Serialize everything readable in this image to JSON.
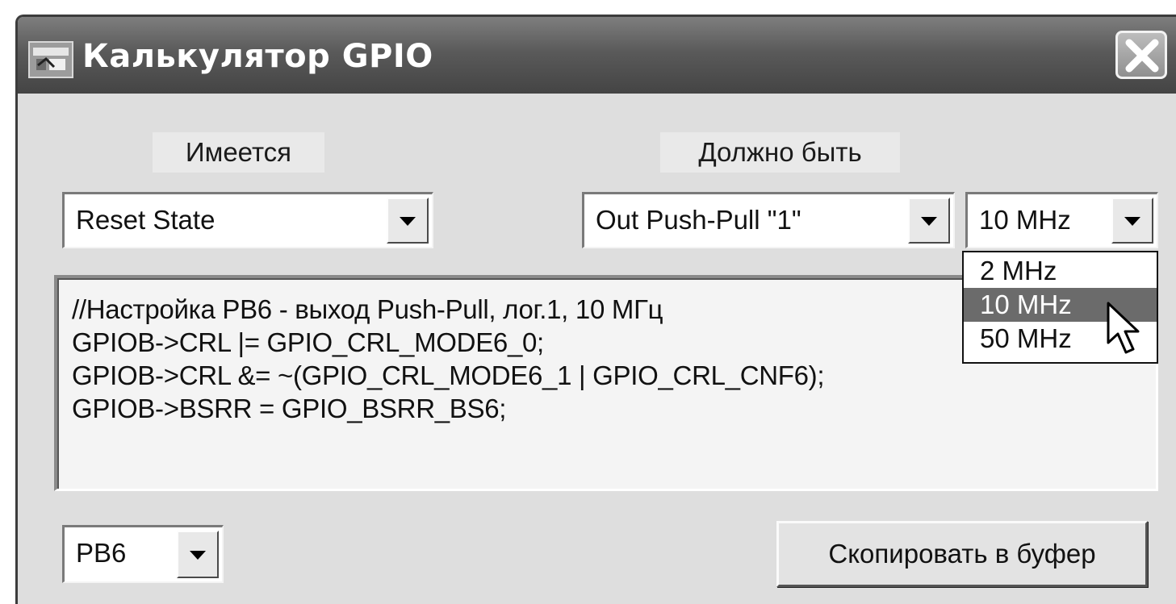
{
  "window": {
    "title": "Калькулятор GPIO"
  },
  "labels": {
    "current": "Имеется",
    "target": "Должно быть"
  },
  "current_state": {
    "value": "Reset State"
  },
  "target_mode": {
    "value": "Out Push-Pull \"1\""
  },
  "speed": {
    "value": "10 MHz",
    "options": [
      "2 MHz",
      "10 MHz",
      "50 MHz"
    ],
    "highlighted": "10 MHz"
  },
  "code_lines": [
    "//Настройка PB6 - выход Push-Pull, лог.1, 10 МГц",
    "GPIOB->CRL |=  GPIO_CRL_MODE6_0;",
    "GPIOB->CRL &= ~(GPIO_CRL_MODE6_1 | GPIO_CRL_CNF6);",
    "GPIOB->BSRR =  GPIO_BSRR_BS6;"
  ],
  "pin": {
    "value": "PB6"
  },
  "copy_button": {
    "label": "Скопировать в буфер"
  },
  "icons": [
    "app-icon",
    "close-icon",
    "chevron-down-icon",
    "mouse-pointer-icon"
  ]
}
